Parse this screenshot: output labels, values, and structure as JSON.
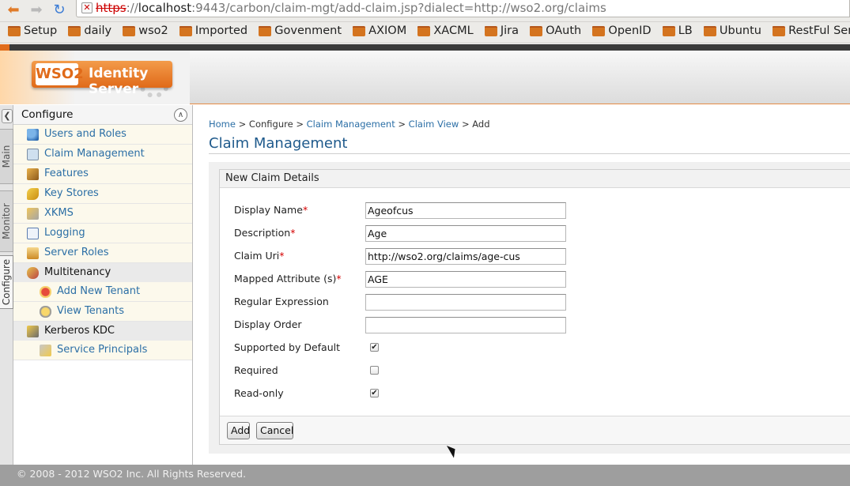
{
  "browser": {
    "url_protocol": "https",
    "url_host": "localhost",
    "url_rest": ":9443/carbon/claim-mgt/add-claim.jsp?dialect=http://wso2.org/claims",
    "bookmarks": [
      "Setup",
      "daily",
      "wso2",
      "Imported",
      "Govenment",
      "AXIOM",
      "XACML",
      "Jira",
      "OAuth",
      "OpenID",
      "LB",
      "Ubuntu",
      "RestFul Services"
    ]
  },
  "header": {
    "logo_wso2": "WSO2",
    "product_name": "Identity Server"
  },
  "vtabs": {
    "main": "Main",
    "monitor": "Monitor",
    "configure": "Configure"
  },
  "sidebar": {
    "title": "Configure",
    "items": [
      {
        "label": "Users and Roles",
        "icon": "users-icon"
      },
      {
        "label": "Claim Management",
        "icon": "claim-icon"
      },
      {
        "label": "Features",
        "icon": "features-icon"
      },
      {
        "label": "Key Stores",
        "icon": "key-icon"
      },
      {
        "label": "XKMS",
        "icon": "xkms-icon"
      },
      {
        "label": "Logging",
        "icon": "logging-icon"
      },
      {
        "label": "Server Roles",
        "icon": "server-roles-icon"
      },
      {
        "label": "Multitenancy",
        "icon": "multitenancy-icon"
      },
      {
        "label": "Add New Tenant",
        "icon": "add-tenant-icon"
      },
      {
        "label": "View Tenants",
        "icon": "view-tenants-icon"
      },
      {
        "label": "Kerberos KDC",
        "icon": "kerberos-icon"
      },
      {
        "label": "Service Principals",
        "icon": "service-principals-icon"
      }
    ]
  },
  "breadcrumb": {
    "home": "Home",
    "sep": ">",
    "configure": "Configure",
    "claim_management": "Claim Management",
    "claim_view": "Claim View",
    "add": "Add"
  },
  "page_title": "Claim Management",
  "form": {
    "legend": "New Claim Details",
    "required_mark": "*",
    "display_name": {
      "label": "Display Name",
      "value": "Ageofcus"
    },
    "description": {
      "label": "Description",
      "value": "Age"
    },
    "claim_uri": {
      "label": "Claim Uri",
      "value": "http://wso2.org/claims/age-cus"
    },
    "mapped_attribute": {
      "label": "Mapped Attribute (s)",
      "value": "AGE"
    },
    "regular_expression": {
      "label": "Regular Expression",
      "value": ""
    },
    "display_order": {
      "label": "Display Order",
      "value": ""
    },
    "supported_by_default": {
      "label": "Supported by Default",
      "checked": true
    },
    "required": {
      "label": "Required",
      "checked": false
    },
    "read_only": {
      "label": "Read-only",
      "checked": true
    },
    "check_glyph": "✔",
    "add_button": "Add",
    "cancel_button": "Cancel"
  },
  "footer": {
    "copyright": "© 2008 - 2012 WSO2 Inc. All Rights Reserved."
  }
}
